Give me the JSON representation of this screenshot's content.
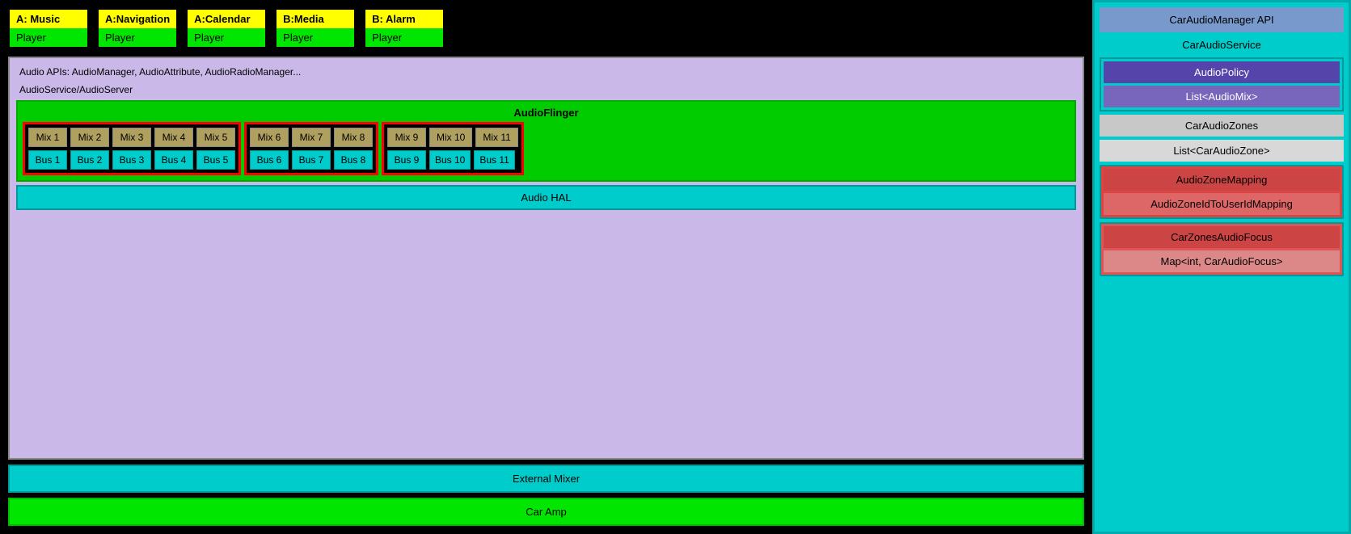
{
  "app_players": [
    {
      "id": "a-music",
      "app_label": "A: Music",
      "player_label": "Player"
    },
    {
      "id": "a-navigation",
      "app_label": "A:Navigation",
      "player_label": "Player"
    },
    {
      "id": "a-calendar",
      "app_label": "A:Calendar",
      "player_label": "Player"
    },
    {
      "id": "b-media",
      "app_label": "B:Media",
      "player_label": "Player"
    },
    {
      "id": "b-alarm",
      "app_label": "B: Alarm",
      "player_label": "Player"
    }
  ],
  "audio_apis_label": "Audio APIs: AudioManager, AudioAttribute, AudioRadioManager...",
  "audio_service_label": "AudioService/AudioServer",
  "audio_flinger_label": "AudioFlinger",
  "zones": [
    {
      "id": "zone-1",
      "mixes": [
        "Mix 1",
        "Mix 2",
        "Mix 3",
        "Mix 4",
        "Mix 5"
      ],
      "buses": [
        "Bus 1",
        "Bus 2",
        "Bus 3",
        "Bus 4",
        "Bus 5"
      ]
    },
    {
      "id": "zone-2",
      "mixes": [
        "Mix 6",
        "Mix 7",
        "Mix 8"
      ],
      "buses": [
        "Bus 6",
        "Bus 7",
        "Bus 8"
      ]
    },
    {
      "id": "zone-3",
      "mixes": [
        "Mix 9",
        "Mix 10",
        "Mix 11"
      ],
      "buses": [
        "Bus 9",
        "Bus 10",
        "Bus 11"
      ]
    }
  ],
  "audio_hal_label": "Audio HAL",
  "external_mixer_label": "External Mixer",
  "car_amp_label": "Car Amp",
  "right_panel": {
    "car_audio_manager_api": "CarAudioManager API",
    "car_audio_service": "CarAudioService",
    "audio_policy": "AudioPolicy",
    "list_audio_mix": "List<AudioMix>",
    "car_audio_zones": "CarAudioZones",
    "list_car_audio_zone": "List<CarAudioZone>",
    "audio_zone_mapping": "AudioZoneMapping",
    "audio_zone_id_mapping": "AudioZoneIdToUserIdMapping",
    "car_zones_audio_focus": "CarZonesAudioFocus",
    "map_car_audio_focus": "Map<int, CarAudioFocus>"
  }
}
